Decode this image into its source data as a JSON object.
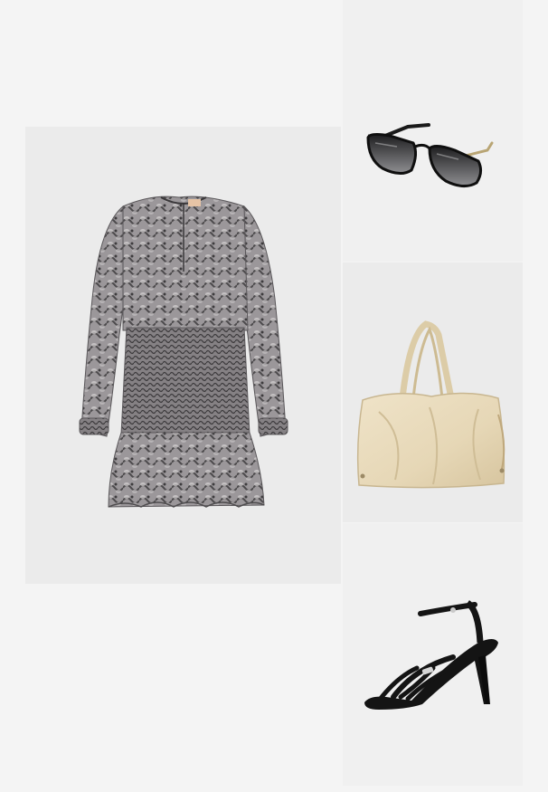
{
  "outfit": {
    "items": [
      {
        "item": "dress",
        "icon": "snake-print-dress"
      },
      {
        "item": "sunglasses",
        "icon": "cat-eye-sunglasses"
      },
      {
        "item": "tote-bag",
        "icon": "cream-tote-bag"
      },
      {
        "item": "heels",
        "icon": "strappy-black-heels"
      }
    ]
  },
  "colors": {
    "page_bg": "#f4f4f4",
    "panel_bg": "#ebebeb",
    "dress_base": "#8a8688",
    "bag": "#e9dcc0",
    "shoe": "#141414"
  }
}
